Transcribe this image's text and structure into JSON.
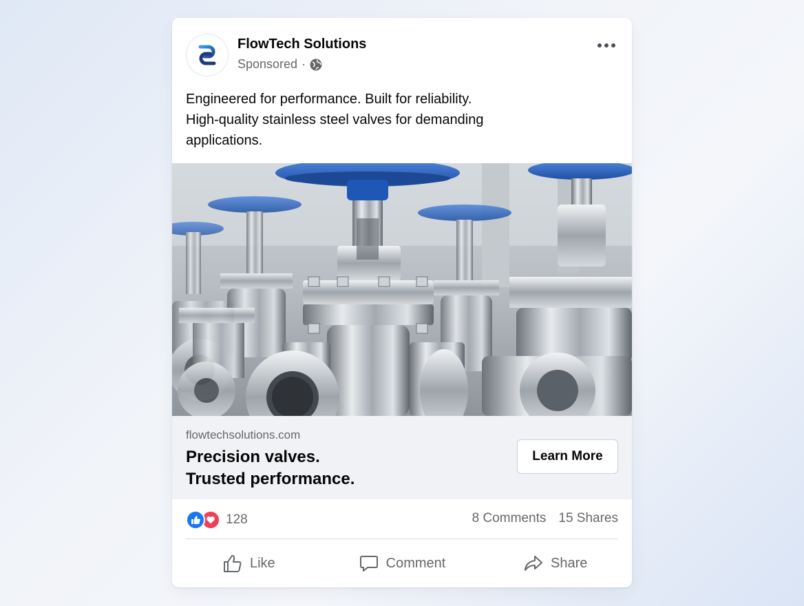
{
  "post": {
    "page_name": "FlowTech Solutions",
    "sponsored_label": "Sponsored",
    "separator": "·",
    "audience_icon": "globe-icon",
    "more_icon": "more-options-icon",
    "caption_lines": [
      "Engineered for performance. Built for reliability.",
      "High-quality stainless steel valves for demanding",
      "applications."
    ]
  },
  "link": {
    "domain": "flowtechsolutions.com",
    "headline_lines": [
      "Precision valves.",
      "Trusted performance."
    ],
    "cta_label": "Learn More"
  },
  "stats": {
    "reaction_count": "128",
    "comments": "8 Comments",
    "shares": "15 Shares"
  },
  "actions": {
    "like": "Like",
    "comment": "Comment",
    "share": "Share"
  },
  "colors": {
    "brand_blue": "#1877f2",
    "love_red": "#f33e58",
    "valve_handle_blue": "#2a5fb8"
  }
}
